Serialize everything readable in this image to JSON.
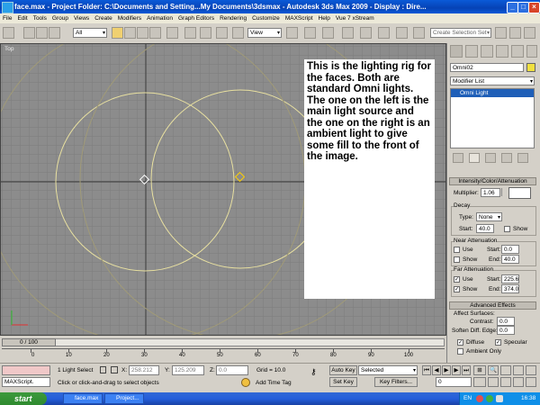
{
  "window": {
    "title": "face.max    - Project Folder: C:\\Documents and Setting...My Documents\\3dsmax    - Autodesk 3ds Max  2009       - Display : Dire..."
  },
  "menu": [
    "File",
    "Edit",
    "Tools",
    "Group",
    "Views",
    "Create",
    "Modifiers",
    "Animation",
    "Graph Editors",
    "Rendering",
    "Customize",
    "MAXScript",
    "Help",
    "Vue 7 xStream"
  ],
  "toolbar": {
    "filter_value": "All",
    "view_value": "View",
    "selection_set_placeholder": "Create Selection Set"
  },
  "viewport": {
    "label": "Top",
    "info_text": "This is the lighting rig for the faces. Both are standard Omni lights. The one on the left is the main light source and the one on the right is an ambient light to give some fill to the front of the image."
  },
  "panel": {
    "object_name": "Omni02",
    "modifier_list": "Modifier List",
    "stack_item": "Omni Light",
    "rollout_intensity": "Intensity/Color/Attenuation",
    "multiplier_label": "Multiplier:",
    "multiplier_value": "1.06",
    "decay_label": "Decay",
    "type_label": "Type:",
    "type_value": "None",
    "start_label": "Start:",
    "decay_start": "40.0",
    "show_label": "Show",
    "near_label": "Near Attenuation",
    "use_label": "Use",
    "near_start": "0.0",
    "end_label": "End:",
    "near_end": "40.0",
    "far_label": "Far Attenuation",
    "far_start": "225.6",
    "far_end": "374.0",
    "rollout_advanced": "Advanced Effects",
    "affect_label": "Affect Surfaces:",
    "contrast_label": "Contrast:",
    "contrast_value": "0.0",
    "soften_label": "Soften Diff. Edge:",
    "soften_value": "0.0",
    "diffuse_label": "Diffuse",
    "specular_label": "Specular",
    "ambient_label": "Ambient Only"
  },
  "timeline": {
    "position": "0 / 100",
    "ticks": [
      "0",
      "10",
      "20",
      "30",
      "40",
      "50",
      "60",
      "70",
      "80",
      "90",
      "100"
    ]
  },
  "status": {
    "maxscript": "MAXScript.",
    "selection": "1 Light Select",
    "x_label": "X:",
    "x_value": "258.212",
    "y_label": "Y:",
    "y_value": "125.209",
    "z_label": "Z:",
    "z_value": "0.0",
    "grid": "Grid = 10.0",
    "auto_key": "Auto Key",
    "selected_value": "Selected",
    "set_key": "Set Key",
    "key_filters": "Key Filters...",
    "frame_value": "0",
    "prompt": "Click or click-and-drag to select objects",
    "add_time_tag": "Add Time Tag"
  },
  "taskbar": {
    "start": "start",
    "tasks": [
      "face.max",
      "Project..."
    ],
    "lang": "EN",
    "clock": "16:38"
  }
}
